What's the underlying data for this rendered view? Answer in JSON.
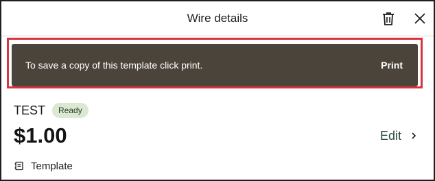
{
  "header": {
    "title": "Wire details",
    "delete_icon": "trash-icon",
    "close_icon": "close-icon"
  },
  "banner": {
    "message": "To save a copy of this template click print.",
    "action_label": "Print",
    "background_color": "#4b443b",
    "highlight_color": "#d6333f"
  },
  "wire": {
    "name": "TEST",
    "status": "Ready",
    "amount": "$1.00",
    "edit_label": "Edit",
    "edit_icon": "chevron-right-icon",
    "type_icon": "template-icon",
    "type_label": "Template"
  },
  "colors": {
    "badge_bg": "#dbe8d2",
    "edit_text": "#2c4a44"
  }
}
